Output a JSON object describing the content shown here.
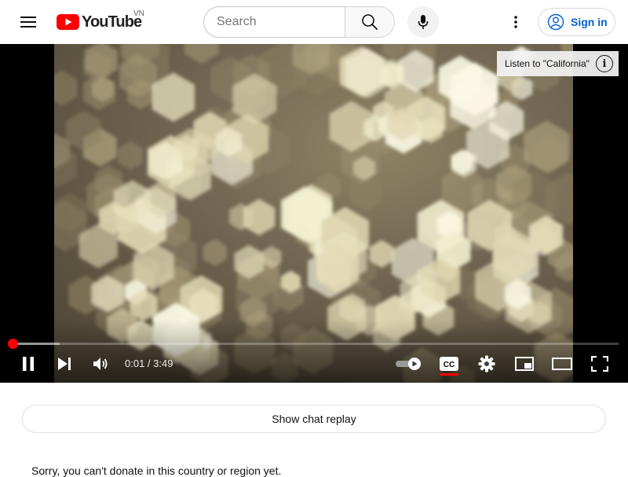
{
  "header": {
    "logo_text": "YouTube",
    "region_code": "VN",
    "search_placeholder": "Search",
    "signin_label": "Sign in"
  },
  "player": {
    "info_card_text": "Listen to \"California\"",
    "time_display": "0:01 / 3:49",
    "progress_fraction": 0.0044,
    "accent_color": "#ff0000",
    "icons": [
      "pause-icon",
      "next-icon",
      "volume-icon",
      "autoplay-toggle",
      "captions-icon",
      "settings-icon",
      "miniplayer-icon",
      "theater-mode-icon",
      "fullscreen-icon"
    ]
  },
  "chat": {
    "show_replay_label": "Show chat replay"
  },
  "donate": {
    "message": "Sorry, you can't donate in this country or region yet."
  }
}
